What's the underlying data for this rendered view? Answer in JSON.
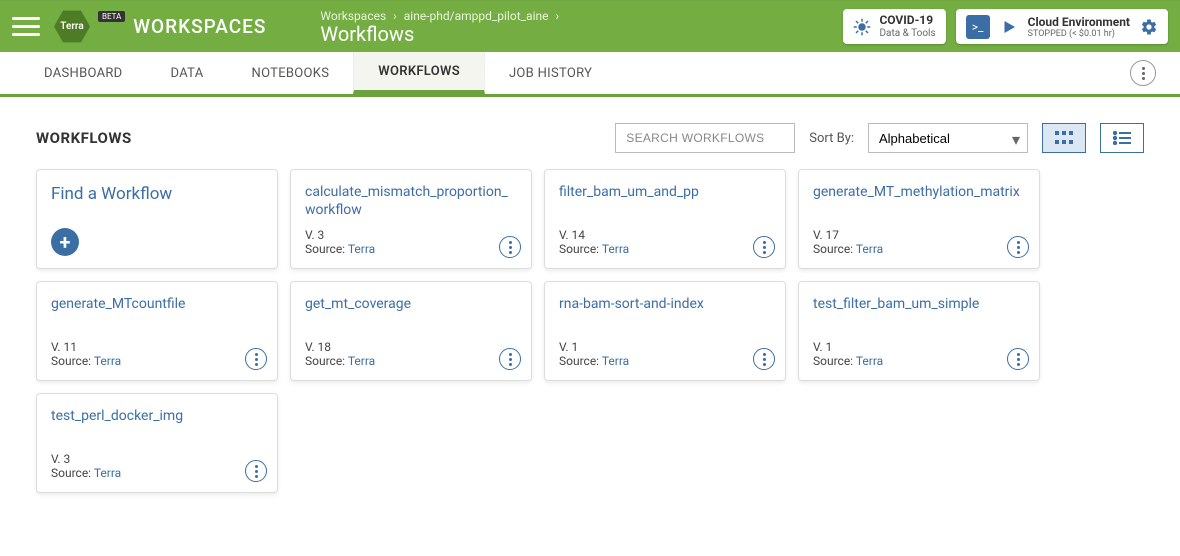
{
  "header": {
    "logo_badge": "BETA",
    "logo_inner": "Terra",
    "logo_text": "WORKSPACES",
    "breadcrumb": {
      "root": "Workspaces",
      "workspace": "aine-phd/amppd_pilot_aine"
    },
    "page_title": "Workflows",
    "covid": {
      "line1": "COVID-19",
      "line2": "Data & Tools"
    },
    "cloud": {
      "line1": "Cloud Environment",
      "line2": "STOPPED (< $0.01 hr)"
    }
  },
  "tabs": [
    "DASHBOARD",
    "DATA",
    "NOTEBOOKS",
    "WORKFLOWS",
    "JOB HISTORY"
  ],
  "active_tab_index": 3,
  "section_title": "WORKFLOWS",
  "search_placeholder": "SEARCH WORKFLOWS",
  "sort_label": "Sort By:",
  "sort_value": "Alphabetical",
  "find_card_title": "Find a Workflow",
  "source_label": "Source:",
  "version_prefix": "V.",
  "workflows": [
    {
      "name": "calculate_mismatch_proportion_workflow",
      "version": "3",
      "source": "Terra"
    },
    {
      "name": "filter_bam_um_and_pp",
      "version": "14",
      "source": "Terra"
    },
    {
      "name": "generate_MT_methylation_matrix",
      "version": "17",
      "source": "Terra"
    },
    {
      "name": "generate_MTcountfile",
      "version": "11",
      "source": "Terra"
    },
    {
      "name": "get_mt_coverage",
      "version": "18",
      "source": "Terra"
    },
    {
      "name": "rna-bam-sort-and-index",
      "version": "1",
      "source": "Terra"
    },
    {
      "name": "test_filter_bam_um_simple",
      "version": "1",
      "source": "Terra"
    },
    {
      "name": "test_perl_docker_img",
      "version": "3",
      "source": "Terra"
    }
  ]
}
